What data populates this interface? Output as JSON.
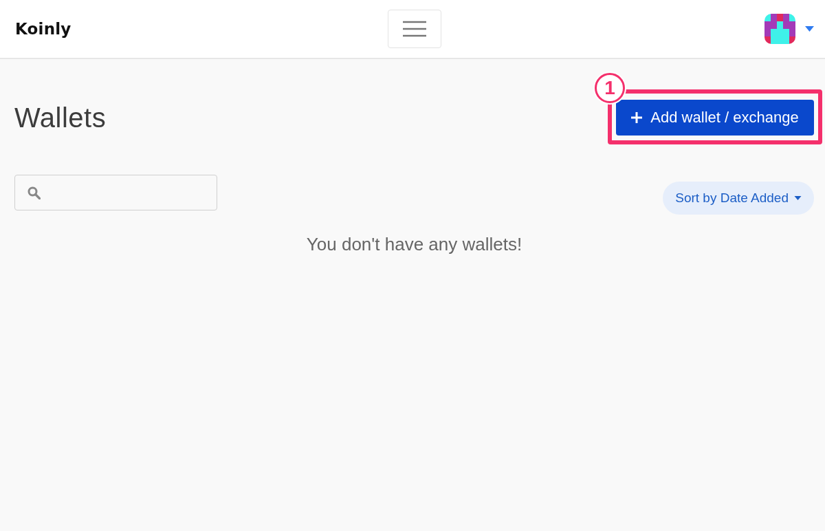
{
  "header": {
    "logo": "Koinly"
  },
  "page": {
    "title": "Wallets",
    "add_button": {
      "label": "Add wallet / exchange",
      "highlighted": true,
      "annotation": "1"
    }
  },
  "toolbar": {
    "sort_button": {
      "label": "Sort by Date Added"
    }
  },
  "empty_message": "You don't have any wallets!"
}
